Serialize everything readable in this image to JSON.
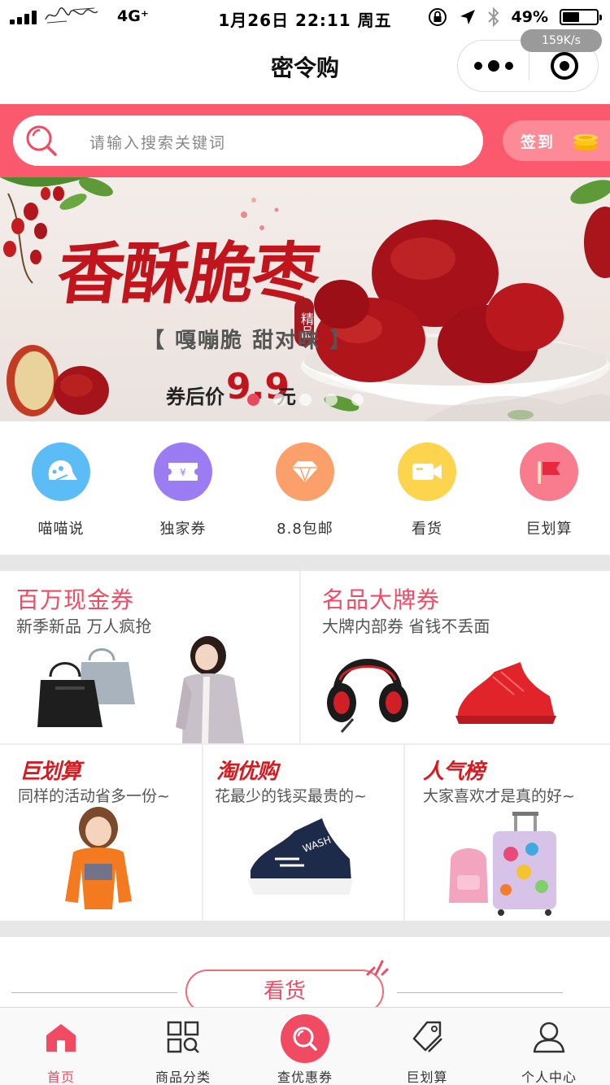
{
  "status_bar": {
    "network": "4G⁺",
    "time": "1月26日 22:11 周五",
    "battery": "49%",
    "battery_level": 0.49,
    "speed": "159K/s"
  },
  "nav_bar": {
    "title": "密令购"
  },
  "search": {
    "placeholder": "请输入搜索关键词",
    "signin_label": "签到"
  },
  "banner": {
    "title": "香酥脆枣",
    "seal": "精品",
    "subtitle": "【 嘎嘣脆  甜对味 】",
    "price_label": "券后价",
    "price": "9.9",
    "price_unit": "元",
    "slide_count": 5,
    "active_slide": 0,
    "colors": {
      "accent": "#c0151c",
      "dot_active": "#e8495e"
    }
  },
  "quick_menu": [
    {
      "label": "喵喵说",
      "icon": "cat-chat-icon",
      "color": "#5cbcf5"
    },
    {
      "label": "独家券",
      "icon": "coupon-icon",
      "color": "#9c7cf2"
    },
    {
      "label": "8.8包邮",
      "icon": "diamond-icon",
      "color": "#fb9f6b"
    },
    {
      "label": "看货",
      "icon": "video-camera-icon",
      "color": "#fcd44e"
    },
    {
      "label": "巨划算",
      "icon": "flag-icon",
      "color": "#f97b8e"
    }
  ],
  "promos": {
    "cash_coupon": {
      "title": "百万现金券",
      "subtitle": "新季新品 万人疯抢"
    },
    "brand_coupon": {
      "title": "名品大牌券",
      "subtitle": "大牌内部券 省钱不丢面"
    },
    "ju_hua_suan": {
      "brand": "巨划算",
      "subtitle": "同样的活动省多一份~"
    },
    "tao_you_gou": {
      "brand": "淘优购",
      "subtitle": "花最少的钱买最贵的~"
    },
    "ren_qi_bang": {
      "brand": "人气榜",
      "subtitle": "大家喜欢才是真的好~"
    }
  },
  "section": {
    "title": "看货"
  },
  "tab_bar": [
    {
      "label": "首页",
      "icon": "home-icon",
      "active": true
    },
    {
      "label": "商品分类",
      "icon": "category-grid-icon",
      "active": false
    },
    {
      "label": "查优惠券",
      "icon": "search-coupon-icon",
      "active": false
    },
    {
      "label": "巨划算",
      "icon": "price-tag-icon",
      "active": false
    },
    {
      "label": "个人中心",
      "icon": "user-icon",
      "active": false
    }
  ],
  "colors": {
    "brand": "#fb5a6e",
    "accent_text": "#f14b63"
  }
}
